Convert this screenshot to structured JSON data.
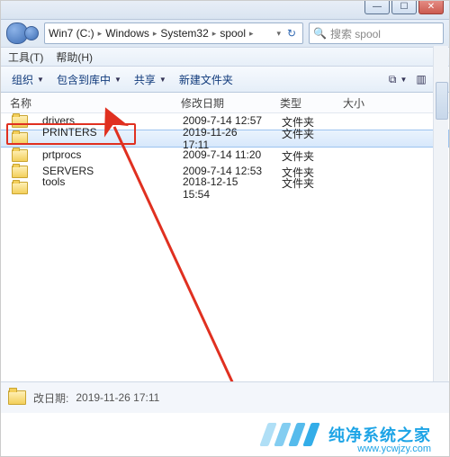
{
  "window_buttons": {
    "min": "—",
    "max": "☐",
    "close": "✕"
  },
  "breadcrumb": [
    "Win7 (C:)",
    "Windows",
    "System32",
    "spool"
  ],
  "refresh_glyph": "↻",
  "search": {
    "icon": "🔍",
    "placeholder": "搜索 spool"
  },
  "menu": [
    "工具(T)",
    "帮助(H)"
  ],
  "toolbar": {
    "organize": "组织",
    "include": "包含到库中",
    "share": "共享",
    "newfolder": "新建文件夹",
    "dd": "▼"
  },
  "columns": {
    "name": "名称",
    "date": "修改日期",
    "type": "类型",
    "size": "大小"
  },
  "rows": [
    {
      "name": "drivers",
      "date": "2009-7-14 12:57",
      "type": "文件夹"
    },
    {
      "name": "PRINTERS",
      "date": "2019-11-26 17:11",
      "type": "文件夹",
      "selected": true,
      "highlight": true
    },
    {
      "name": "prtprocs",
      "date": "2009-7-14 11:20",
      "type": "文件夹"
    },
    {
      "name": "SERVERS",
      "date": "2009-7-14 12:53",
      "type": "文件夹"
    },
    {
      "name": "tools",
      "date": "2018-12-15 15:54",
      "type": "文件夹"
    }
  ],
  "status": {
    "label": "改日期:",
    "value": "2019-11-26 17:11"
  },
  "watermark": {
    "text": "纯净系统之家",
    "url": "www.ycwjzy.com"
  }
}
